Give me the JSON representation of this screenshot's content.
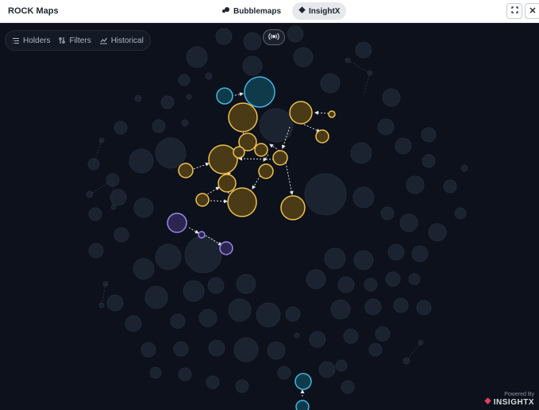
{
  "app": {
    "title": "ROCK Maps"
  },
  "tabs": [
    {
      "label": "Bubblemaps",
      "active": false
    },
    {
      "label": "InsightX",
      "active": true
    }
  ],
  "window_controls": {
    "expand_icon": "expand-icon",
    "close_icon": "close-icon"
  },
  "toolbar": {
    "holders_label": "Holders",
    "filters_label": "Filters",
    "historical_label": "Historical"
  },
  "live_button": {
    "icon": "broadcast-icon"
  },
  "footer": {
    "powered_by": "Powered By",
    "brand": "INSIGHTX"
  },
  "colors": {
    "background": "#0c111b",
    "gold": "#f0c04e",
    "gold_fill": "#4a3b16",
    "cyan": "#42b6e0",
    "cyan_fill": "#0f3a4a",
    "purple": "#9a86e8",
    "purple_fill": "#2b2550",
    "ghost": "#1d2431"
  }
}
